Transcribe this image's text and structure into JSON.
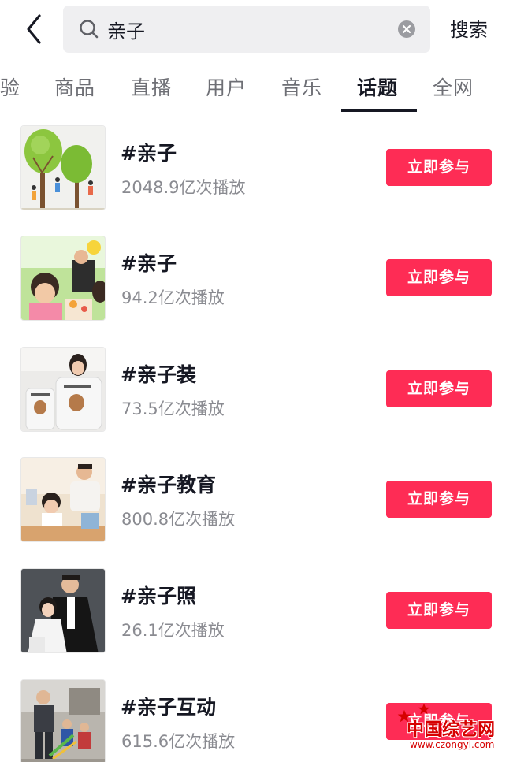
{
  "header": {
    "back_icon": "chevron-left-icon",
    "search_icon": "search-icon",
    "search_value": "亲子",
    "clear_icon": "clear-icon",
    "search_button": "搜索"
  },
  "tabs": [
    {
      "label": "验",
      "active": false
    },
    {
      "label": "商品",
      "active": false
    },
    {
      "label": "直播",
      "active": false
    },
    {
      "label": "用户",
      "active": false
    },
    {
      "label": "音乐",
      "active": false
    },
    {
      "label": "话题",
      "active": true
    },
    {
      "label": "全网",
      "active": false
    }
  ],
  "topics": [
    {
      "title": "#亲子",
      "plays": "2048.9亿次播放",
      "button": "立即参与"
    },
    {
      "title": "#亲子",
      "plays": "94.2亿次播放",
      "button": "立即参与"
    },
    {
      "title": "#亲子装",
      "plays": "73.5亿次播放",
      "button": "立即参与"
    },
    {
      "title": "#亲子教育",
      "plays": "800.8亿次播放",
      "button": "立即参与"
    },
    {
      "title": "#亲子照",
      "plays": "26.1亿次播放",
      "button": "立即参与"
    },
    {
      "title": "#亲子互动",
      "plays": "615.6亿次播放",
      "button": "立即参与"
    }
  ],
  "watermark": {
    "title": "中国综艺网",
    "url": "www.czongyi.com"
  },
  "colors": {
    "accent": "#fe2c55",
    "text_primary": "#161823",
    "text_secondary": "#8a8b91",
    "search_bg": "#efeff1"
  }
}
